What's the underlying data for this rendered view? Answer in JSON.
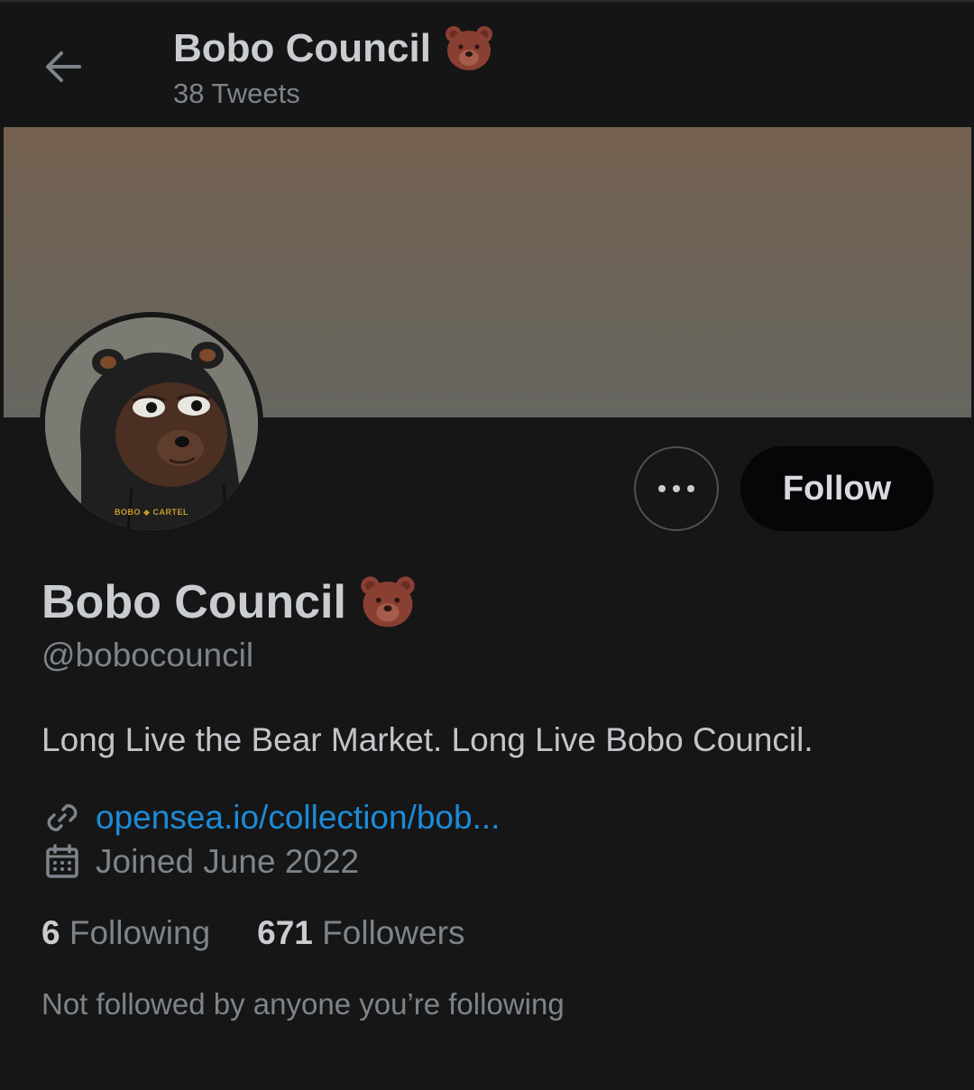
{
  "header": {
    "title": "Bobo Council",
    "title_emoji": "bear-face-emoji",
    "tweet_count": "38 Tweets"
  },
  "profile": {
    "name": "Bobo Council",
    "name_emoji": "bear-face-emoji",
    "handle": "@bobocouncil",
    "bio": "Long Live the Bear Market. Long Live Bobo Council.",
    "link": "opensea.io/collection/bob...",
    "joined": "Joined June 2022",
    "avatar_badge_text": "BOBO ◆ CARTEL"
  },
  "actions": {
    "more_icon": "more-horizontal-icon",
    "follow_label": "Follow"
  },
  "stats": {
    "following_count": "6",
    "following_label": "Following",
    "followers_count": "671",
    "followers_label": "Followers"
  },
  "social_context": "Not followed by anyone you’re following",
  "colors": {
    "background": "#161616",
    "link": "#1d8bd8",
    "primary_text": "#c9ccd0",
    "secondary_text": "#7d848b"
  }
}
